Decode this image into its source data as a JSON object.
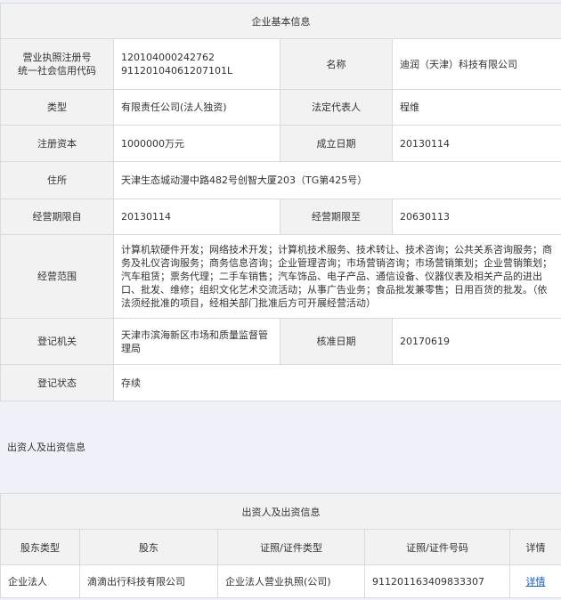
{
  "basic_info": {
    "title": "企业基本信息",
    "reg_no_label": "营业执照注册号\n统一社会信用代码",
    "reg_no_value": "120104000242762\n91120104061207101L",
    "name_label": "名称",
    "name_value": "迪润（天津）科技有限公司",
    "type_label": "类型",
    "type_value": "有限责任公司(法人独资)",
    "legal_rep_label": "法定代表人",
    "legal_rep_value": "程维",
    "capital_label": "注册资本",
    "capital_value": "1000000万元",
    "established_label": "成立日期",
    "established_value": "20130114",
    "address_label": "住所",
    "address_value": "天津生态城动漫中路482号创智大厦203（TG第425号）",
    "term_from_label": "经营期限自",
    "term_from_value": "20130114",
    "term_to_label": "经营期限至",
    "term_to_value": "20630113",
    "scope_label": "经营范围",
    "scope_value": "计算机软硬件开发；网络技术开发；计算机技术服务、技术转让、技术咨询；公共关系咨询服务；商务及礼仪咨询服务；商务信息咨询；企业管理咨询；市场营销咨询；市场营销策划；企业营销策划；汽车租赁；票务代理；二手车销售；汽车饰品、电子产品、通信设备、仪器仪表及相关产品的进出口、批发、维修；组织文化艺术交流活动；从事广告业务；食品批发兼零售；日用百货的批发。（依法须经批准的项目，经相关部门批准后方可开展经营活动）",
    "authority_label": "登记机关",
    "authority_value": "天津市滨海新区市场和质量监督管理局",
    "approval_label": "核准日期",
    "approval_value": "20170619",
    "status_label": "登记状态",
    "status_value": "存续"
  },
  "section_title": "出资人及出资信息",
  "shareholders": {
    "title": "出资人及出资信息",
    "columns": [
      "股东类型",
      "股东",
      "证照/证件类型",
      "证照/证件号码",
      "详情"
    ],
    "rows": [
      {
        "type": "企业法人",
        "name": "滴滴出行科技有限公司",
        "cert_type": "企业法人营业执照(公司)",
        "cert_no": "911201163409833307",
        "detail": "详情"
      }
    ]
  }
}
